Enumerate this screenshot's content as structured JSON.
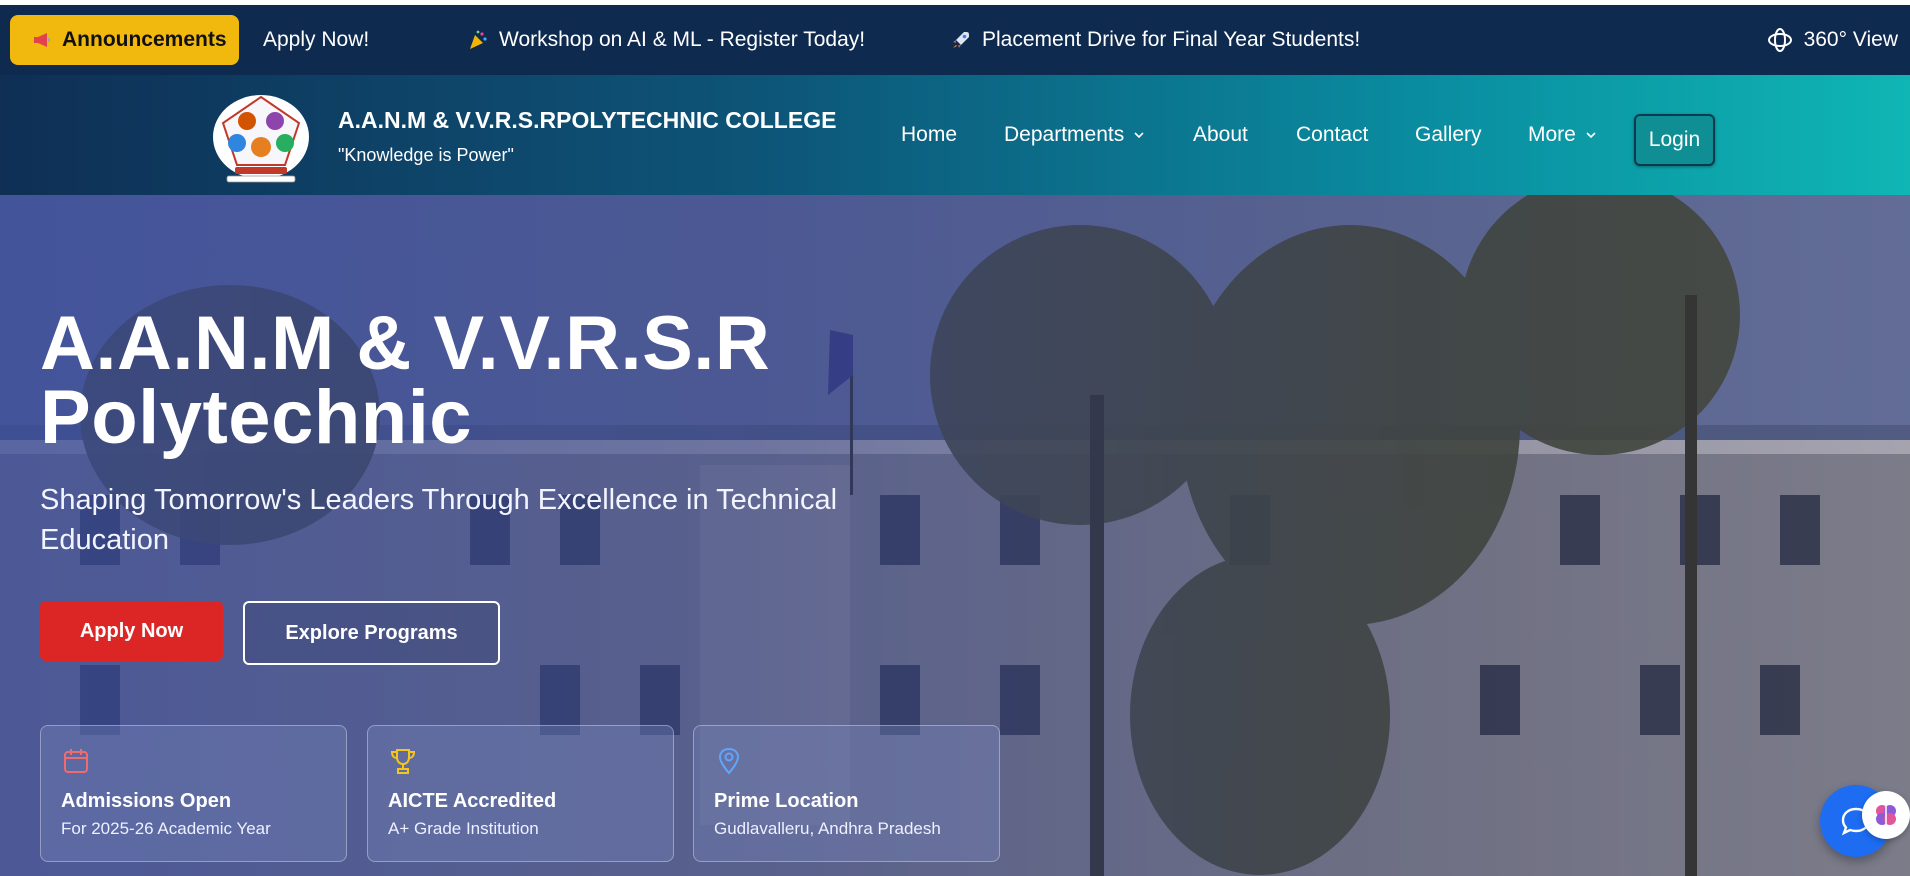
{
  "announcement_bar": {
    "badge_label": "Announcements",
    "ticker": [
      "Apply Now!",
      "Workshop on AI & ML - Register Today!",
      "Placement Drive for Final Year Students!"
    ],
    "view360_label": "360° View"
  },
  "header": {
    "college_name": "A.A.N.M & V.V.R.S.RPOLYTECHNIC COLLEGE",
    "tagline": "\"Knowledge is Power\"",
    "nav": {
      "home": "Home",
      "departments": "Departments",
      "about": "About",
      "contact": "Contact",
      "gallery": "Gallery",
      "more": "More"
    },
    "login_label": "Login"
  },
  "hero": {
    "title_line1": "A.A.N.M & V.V.R.S.R",
    "title_line2": "Polytechnic",
    "subtitle": "Shaping Tomorrow's Leaders Through Excellence in Technical Education",
    "apply_label": "Apply Now",
    "explore_label": "Explore Programs",
    "cards": [
      {
        "icon": "calendar-icon",
        "title": "Admissions Open",
        "subtitle": "For 2025-26 Academic Year"
      },
      {
        "icon": "trophy-icon",
        "title": "AICTE Accredited",
        "subtitle": "A+ Grade Institution"
      },
      {
        "icon": "location-pin-icon",
        "title": "Prime Location",
        "subtitle": "Gudlavalleru, Andhra Pradesh"
      }
    ]
  },
  "colors": {
    "announcement_bg": "#0f2a4f",
    "badge_yellow": "#f1b90d",
    "apply_red": "#dc2626",
    "header_teal": "#0fb6b4",
    "chat_blue": "#1d6cf2"
  }
}
